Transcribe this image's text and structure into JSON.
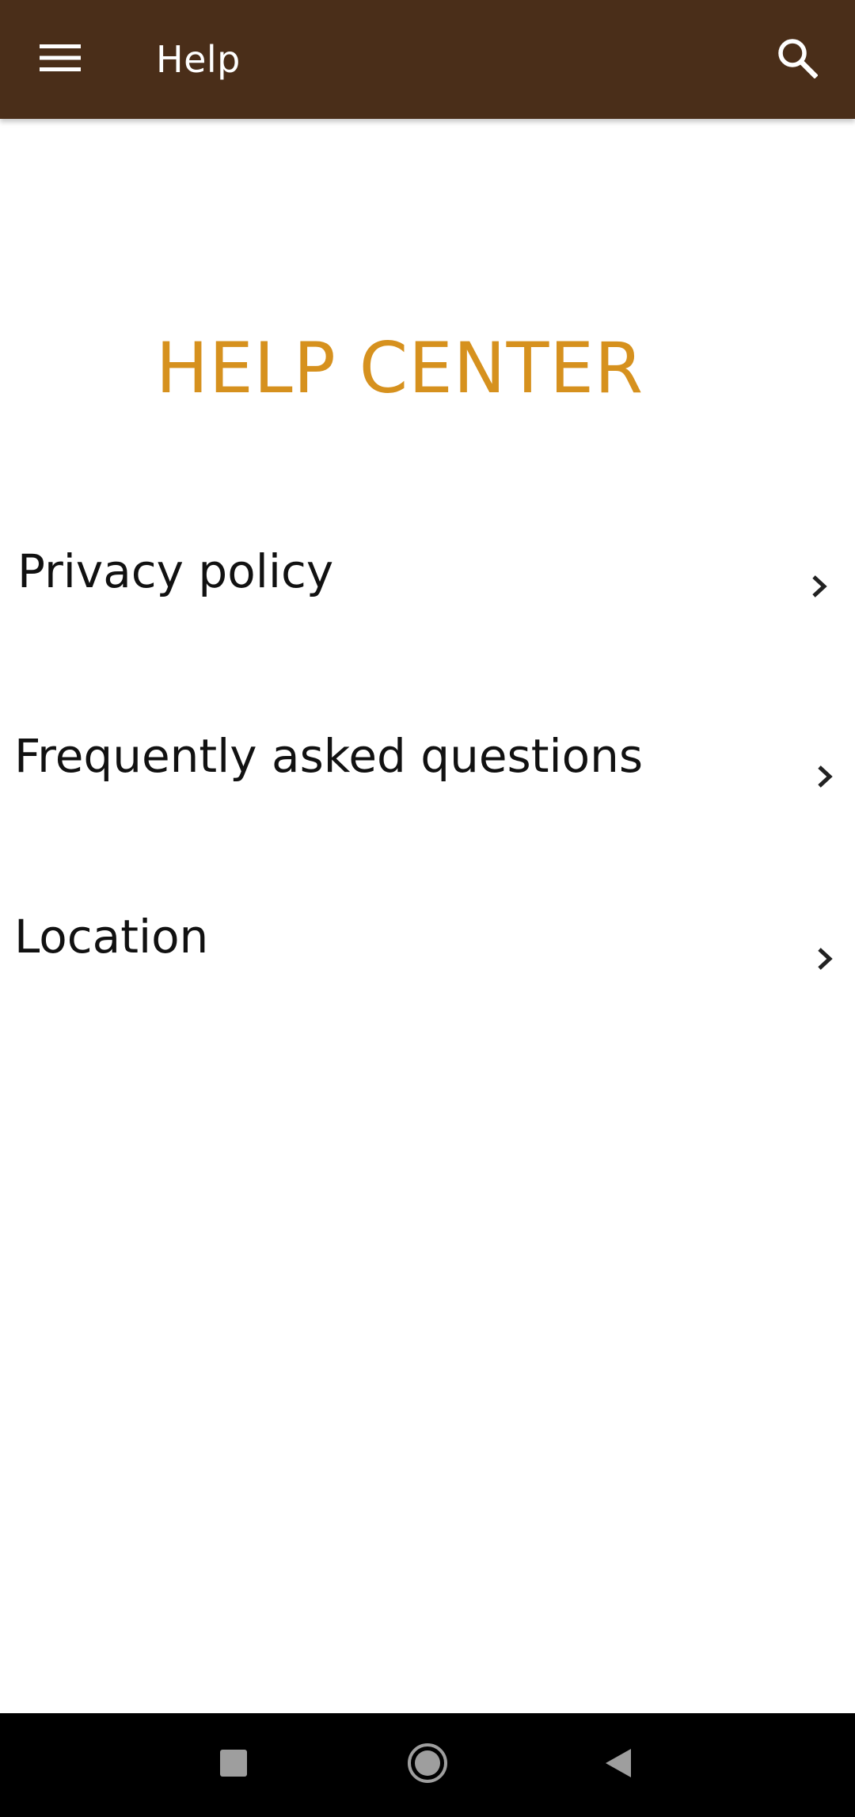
{
  "appbar": {
    "title": "Help",
    "menu_icon": "hamburger-menu-icon",
    "search_icon": "search-icon",
    "background_color": "#4a2e19"
  },
  "main": {
    "heading": "HELP CENTER",
    "heading_color": "#d6911e",
    "items": [
      {
        "label": "Privacy policy",
        "icon": "chevron-right-icon"
      },
      {
        "label": "Frequently asked questions",
        "icon": "chevron-right-icon"
      },
      {
        "label": "Location",
        "icon": "chevron-right-icon"
      }
    ]
  },
  "navbar": {
    "recents_icon": "square-recents-icon",
    "home_icon": "circle-home-icon",
    "back_icon": "triangle-back-icon"
  }
}
